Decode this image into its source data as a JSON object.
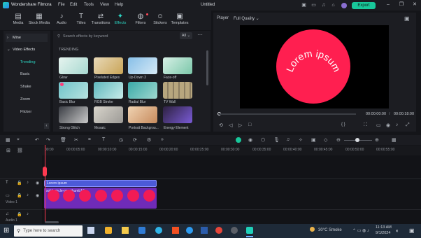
{
  "app": {
    "name": "Wondershare Filmora",
    "doc_title": "Untitled",
    "export_label": "Export"
  },
  "menu": [
    "File",
    "Edit",
    "Tools",
    "View",
    "Help"
  ],
  "toolbar": [
    {
      "label": "Media",
      "icon": "media-icon"
    },
    {
      "label": "Stock Media",
      "icon": "stock-media-icon"
    },
    {
      "label": "Audio",
      "icon": "audio-icon"
    },
    {
      "label": "Titles",
      "icon": "titles-icon"
    },
    {
      "label": "Transitions",
      "icon": "transitions-icon"
    },
    {
      "label": "Effects",
      "icon": "effects-icon"
    },
    {
      "label": "Filters",
      "icon": "filters-icon"
    },
    {
      "label": "Stickers",
      "icon": "stickers-icon"
    },
    {
      "label": "Templates",
      "icon": "templates-icon"
    }
  ],
  "sidebar": {
    "items": [
      "Mine",
      "Video Effects",
      "Trending",
      "Basic",
      "Shake",
      "Zoom",
      "Flicker"
    ]
  },
  "effects": {
    "search_placeholder": "Search effects by keyword",
    "filter": "All",
    "section": "TRENDING",
    "items": [
      "Glow",
      "Pixelated Edges",
      "Up-Down 2",
      "Face-off",
      "Basic Blur",
      "RGB Stroke",
      "Radial Blur",
      "TV Wall",
      "Strong Glitch",
      "Mosaic",
      "Portrait Backgrou...",
      "Energy Element"
    ]
  },
  "player": {
    "label": "Player",
    "quality": "Full Quality",
    "preview_text": "Lorem ipsum",
    "time_current": "00:00:00:00",
    "time_total": "00:00:18:00",
    "brackets": "{  }"
  },
  "ruler": [
    "00:00",
    "00:00:05:00",
    "00:00:10:00",
    "00:00:15:00",
    "00:00:20:00",
    "00:00:25:00",
    "00:00:30:00",
    "00:00:35:00",
    "00:00:40:00",
    "00:00:45:00",
    "00:00:50:00",
    "00:00:55:00"
  ],
  "tracks": {
    "title_clip": "Lorem ipsum",
    "video_clip": "solid-circle-png-thumb16",
    "video_label": "Video 1",
    "audio_label": "Audio 1"
  },
  "taskbar": {
    "search": "Type here to search",
    "weather": "30°C  Smoke",
    "time": "11:13 AM",
    "date": "9/1/2024"
  },
  "colors": {
    "accent": "#2cd6c4",
    "export": "#18c79a",
    "circle": "#ff1f50",
    "clip_title": "#4c5ad8",
    "clip_video": "#6f2bb8"
  }
}
